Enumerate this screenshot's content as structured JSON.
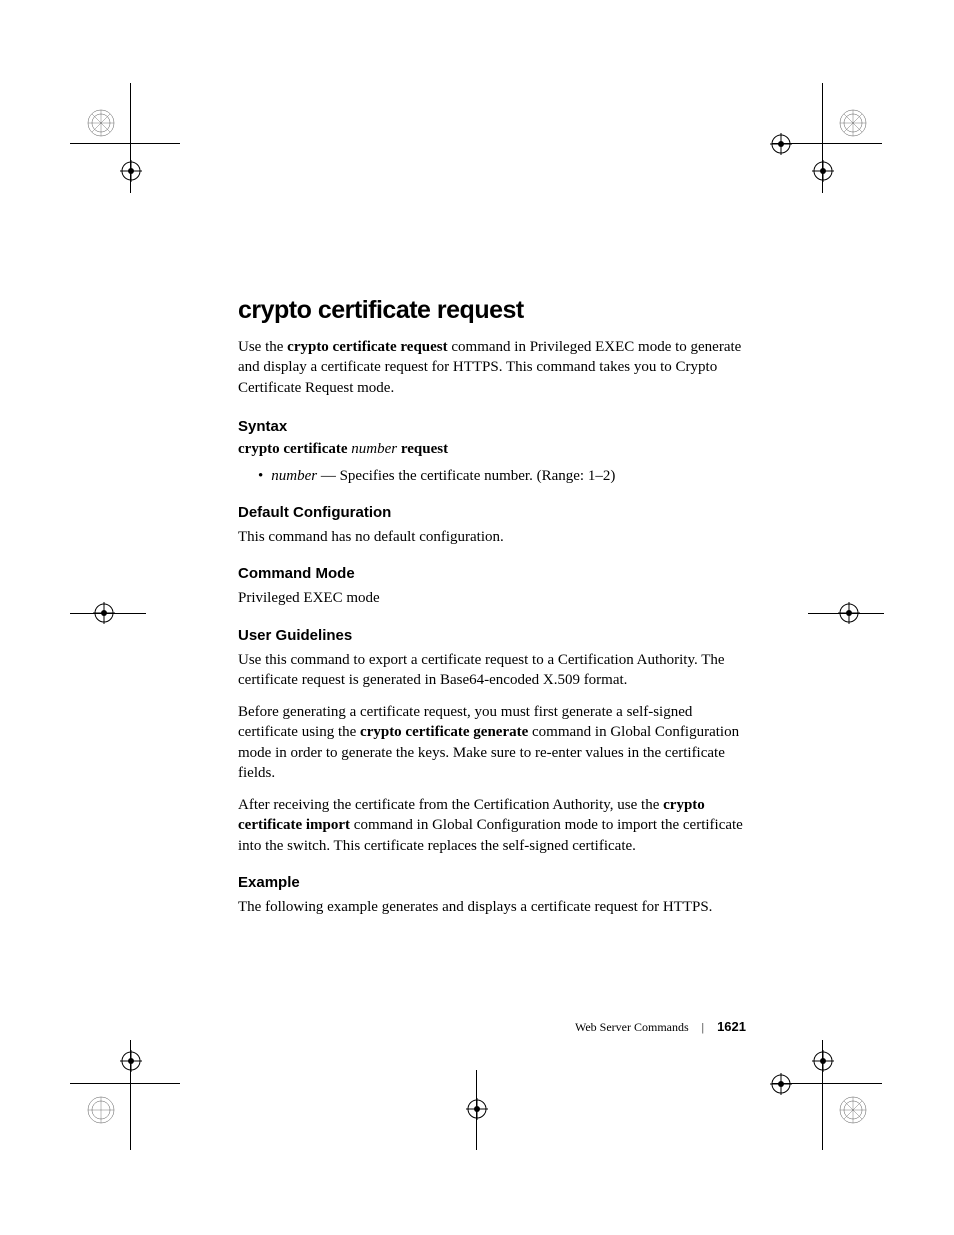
{
  "title": "crypto certificate request",
  "intro": {
    "prefix": "Use the ",
    "cmd": "crypto certificate request",
    "suffix": " command in Privileged EXEC mode to generate and display a certificate request for HTTPS. This command takes you to Crypto Certificate Request mode."
  },
  "sections": {
    "syntax": {
      "heading": "Syntax",
      "command": {
        "p1": "crypto certificate ",
        "param": "number",
        "p2": " request"
      },
      "bullet": {
        "param": "number",
        "text": " — Specifies the certificate number. (Range: 1–2)"
      }
    },
    "default": {
      "heading": "Default Configuration",
      "text": "This command has no default configuration."
    },
    "mode": {
      "heading": "Command Mode",
      "text": "Privileged EXEC mode"
    },
    "guidelines": {
      "heading": "User Guidelines",
      "p1": "Use this command to export a certificate request to a Certification Authority. The certificate request is generated in Base64-encoded X.509 format.",
      "p2a": "Before generating a certificate request, you must first generate a self-signed certificate using the ",
      "p2cmd": "crypto certificate generate",
      "p2b": " command in Global Configuration mode in order to generate the keys. Make sure to re-enter values in the certificate fields.",
      "p3a": "After receiving the certificate from the Certification Authority, use the ",
      "p3cmd": "crypto certificate import",
      "p3b": " command in Global Configuration mode to import the certificate into the switch. This certificate replaces the self-signed certificate."
    },
    "example": {
      "heading": "Example",
      "text": "The following example generates and displays a certificate request for HTTPS."
    }
  },
  "footer": {
    "section": "Web Server Commands",
    "page": "1621"
  }
}
